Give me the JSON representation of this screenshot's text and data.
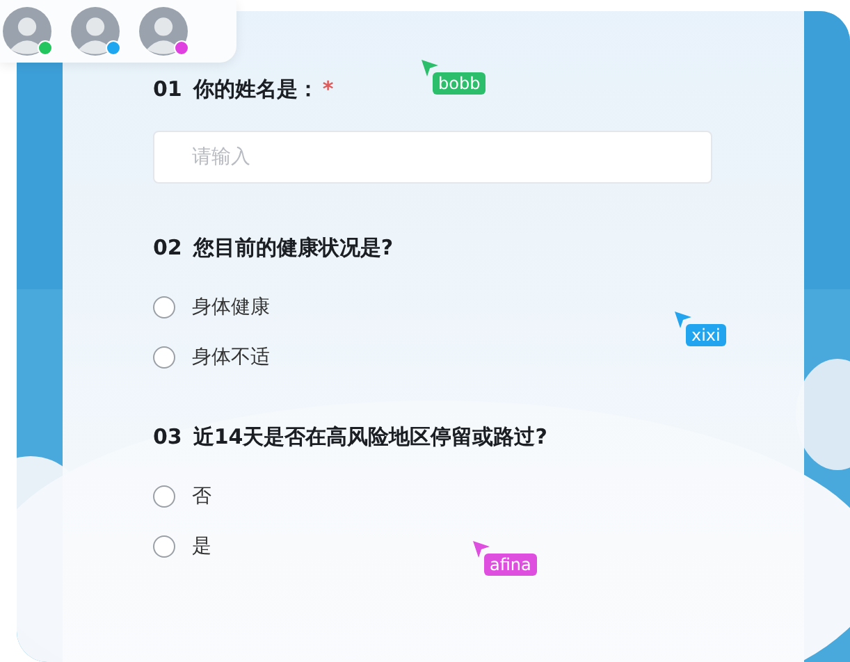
{
  "collaborators": [
    {
      "color": "#22c55e"
    },
    {
      "color": "#1ea7f0"
    },
    {
      "color": "#e040e0"
    }
  ],
  "questions": [
    {
      "number": "01",
      "title": "你的姓名是：",
      "required_mark": "*",
      "kind": "text",
      "placeholder": "请输入"
    },
    {
      "number": "02",
      "title": "您目前的健康状况是?",
      "kind": "radio",
      "options": [
        {
          "label": "身体健康",
          "selected": false
        },
        {
          "label": "身体不适",
          "selected": false
        }
      ]
    },
    {
      "number": "03",
      "title": "近14天是否在高风险地区停留或路过?",
      "kind": "radio",
      "options": [
        {
          "label": "否",
          "selected": false
        },
        {
          "label": "是",
          "selected": false
        }
      ]
    }
  ],
  "cursors": [
    {
      "name": "bobb",
      "color": "#2dbe6c"
    },
    {
      "name": "xixi",
      "color": "#22a5ee"
    },
    {
      "name": "afina",
      "color": "#df4fdf"
    }
  ]
}
